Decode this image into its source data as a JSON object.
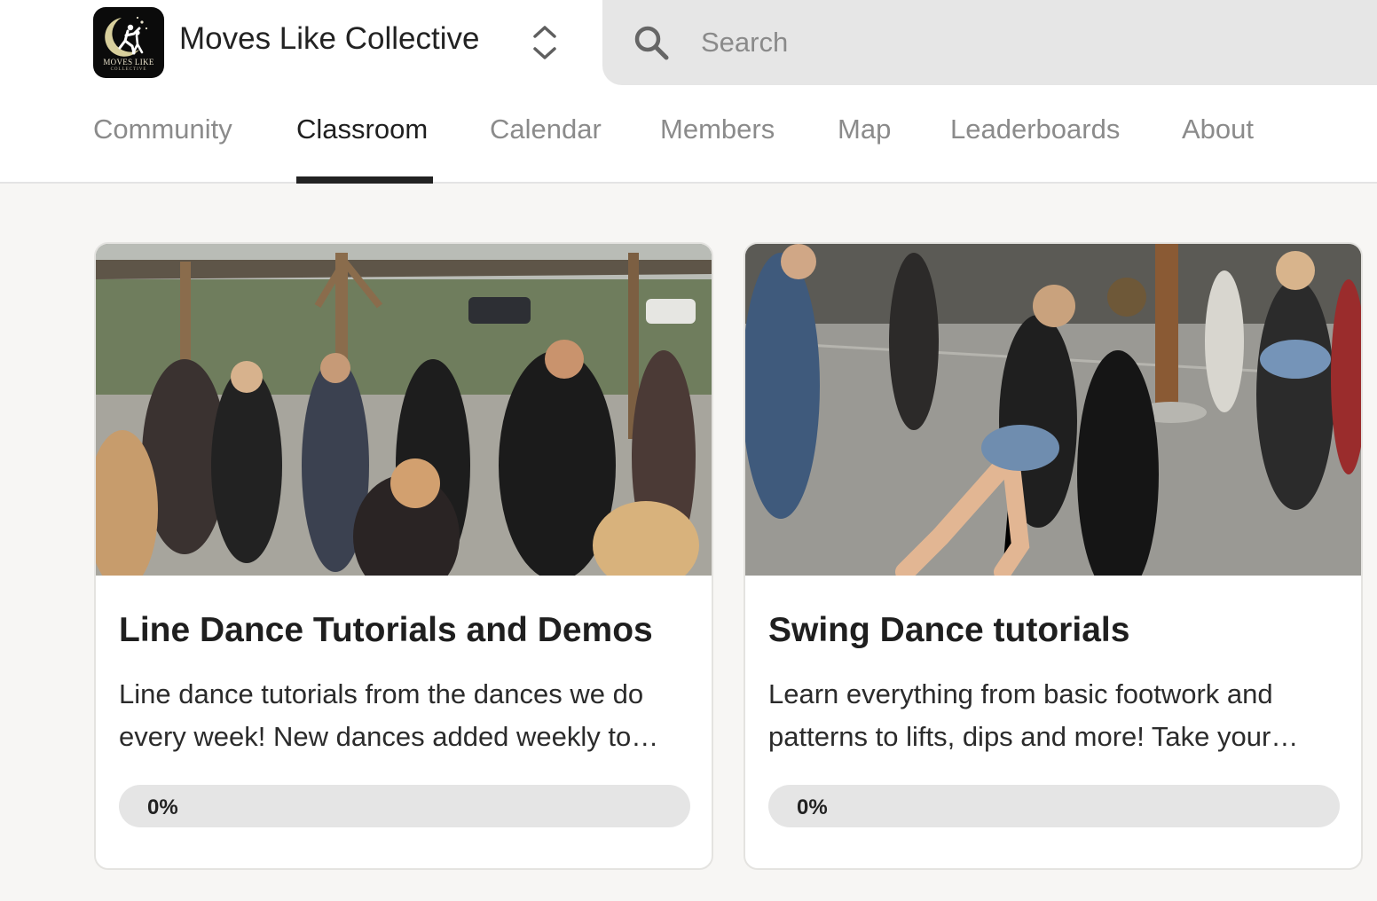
{
  "header": {
    "community_name": "Moves Like Collective",
    "logo": {
      "text": "MOVES LIKE",
      "subtext": "COLLECTIVE"
    },
    "search_placeholder": "Search"
  },
  "nav": {
    "tabs": [
      {
        "label": "Community",
        "active": false
      },
      {
        "label": "Classroom",
        "active": true
      },
      {
        "label": "Calendar",
        "active": false
      },
      {
        "label": "Members",
        "active": false
      },
      {
        "label": "Map",
        "active": false
      },
      {
        "label": "Leaderboards",
        "active": false
      },
      {
        "label": "About",
        "active": false
      }
    ]
  },
  "courses": [
    {
      "title": "Line Dance Tutorials and Demos",
      "description": "Line dance tutorials from the dances we do every week! New dances added weekly to…",
      "progress": 0,
      "progress_label": "0%"
    },
    {
      "title": "Swing Dance tutorials",
      "description": "Learn everything from basic footwork and patterns to lifts, dips and more! Take your…",
      "progress": 0,
      "progress_label": "0%"
    }
  ],
  "colors": {
    "active_tab": "#1f1f1f",
    "inactive_tab": "#8b8b8b",
    "progress_track": "#e5e5e5",
    "progress_fill": "#2f9e5b",
    "page_background": "#f7f6f4"
  }
}
